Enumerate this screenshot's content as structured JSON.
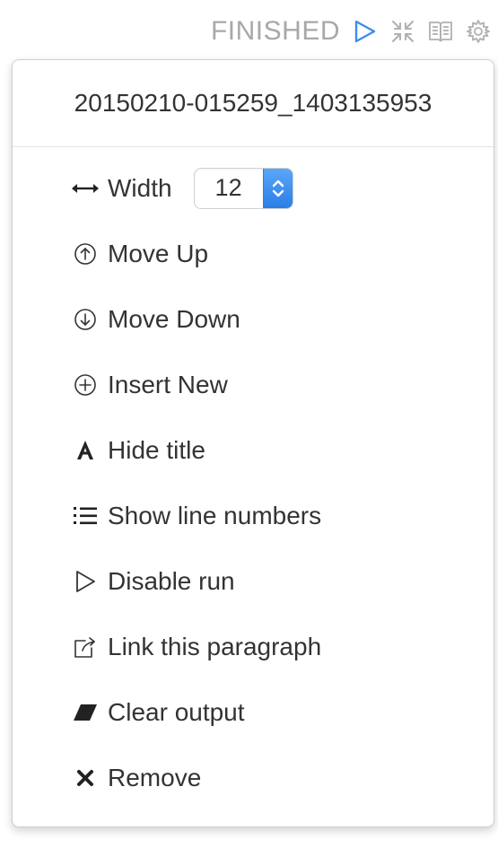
{
  "toolbar": {
    "status": "FINISHED",
    "icons": [
      "play-icon",
      "collapse-icon",
      "book-icon",
      "gear-icon"
    ]
  },
  "dropdown": {
    "paragraph_id": "20150210-015259_1403135953",
    "width": {
      "label": "Width",
      "value": "12"
    },
    "items": [
      {
        "label": "Move Up",
        "icon": "arrow-up-circle-icon"
      },
      {
        "label": "Move Down",
        "icon": "arrow-down-circle-icon"
      },
      {
        "label": "Insert New",
        "icon": "plus-circle-icon"
      },
      {
        "label": "Hide title",
        "icon": "font-icon"
      },
      {
        "label": "Show line numbers",
        "icon": "list-numbered-icon"
      },
      {
        "label": "Disable run",
        "icon": "play-outline-icon"
      },
      {
        "label": "Link this paragraph",
        "icon": "share-icon"
      },
      {
        "label": "Clear output",
        "icon": "eraser-icon"
      },
      {
        "label": "Remove",
        "icon": "close-icon"
      }
    ]
  },
  "colors": {
    "accent": "#3b8ee8",
    "status_text": "#a8a8a8",
    "icon_gray": "#b0b0b0"
  }
}
